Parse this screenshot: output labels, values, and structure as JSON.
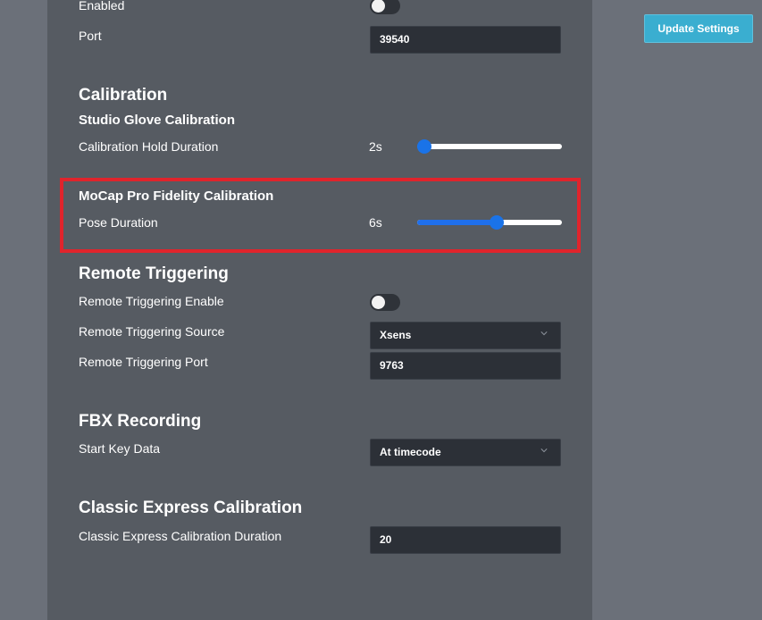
{
  "top": {
    "enabled_label": "Enabled",
    "enabled_state": false,
    "port_label": "Port",
    "port_value": "39540"
  },
  "calibration": {
    "heading": "Calibration",
    "studio_glove": {
      "heading": "Studio Glove Calibration",
      "hold_label": "Calibration Hold Duration",
      "hold_value_text": "2s",
      "hold_fraction": 0.05
    },
    "mocap_pro": {
      "heading": "MoCap Pro Fidelity Calibration",
      "pose_label": "Pose Duration",
      "pose_value_text": "6s",
      "pose_fraction": 0.55
    }
  },
  "remote_triggering": {
    "heading": "Remote Triggering",
    "enable_label": "Remote Triggering Enable",
    "enable_state": false,
    "source_label": "Remote Triggering Source",
    "source_value": "Xsens",
    "port_label": "Remote Triggering Port",
    "port_value": "9763"
  },
  "fbx_recording": {
    "heading": "FBX Recording",
    "start_key_label": "Start Key Data",
    "start_key_value": "At timecode"
  },
  "classic_express": {
    "heading": "Classic Express Calibration",
    "duration_label": "Classic Express Calibration Duration",
    "duration_value": "20"
  },
  "actions": {
    "update_label": "Update Settings"
  },
  "colors": {
    "highlight": "#e0242c",
    "accent": "#1a73e8",
    "button": "#3aaed0"
  },
  "icons": {
    "select_arrow": "chevron-down-icon"
  }
}
